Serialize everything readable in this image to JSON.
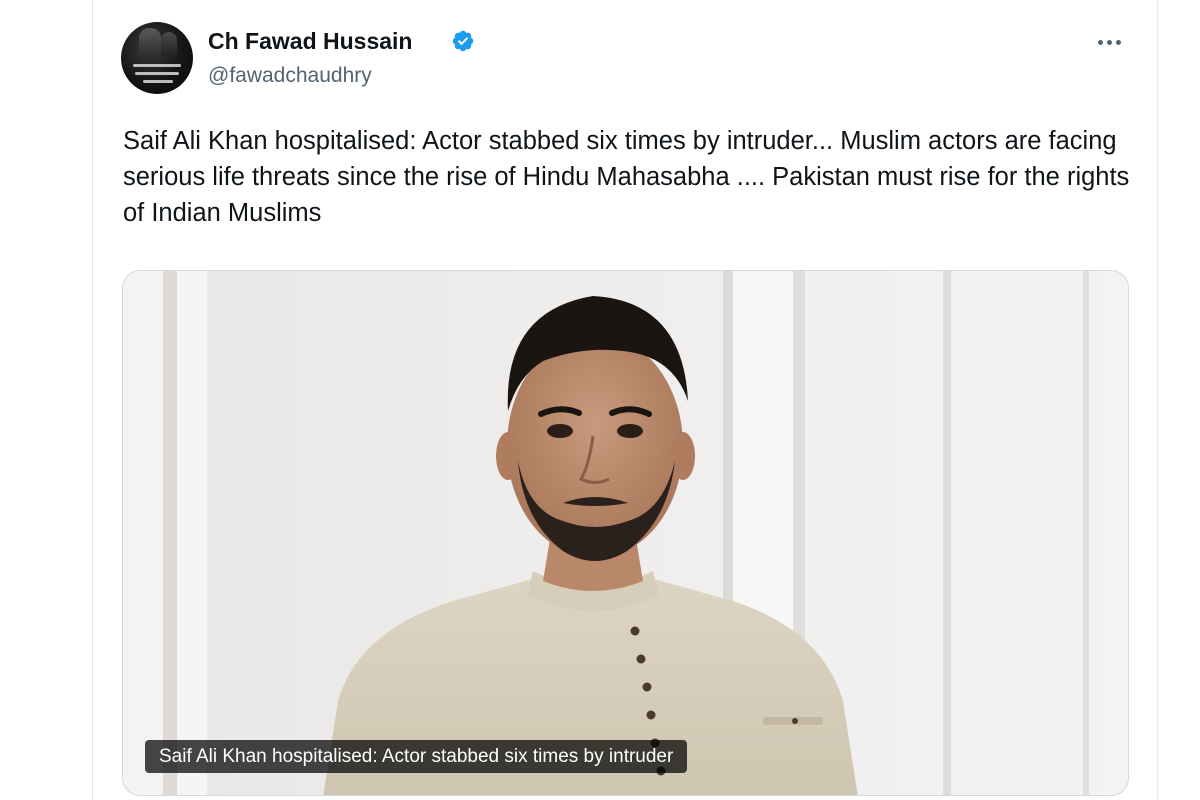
{
  "author": {
    "display_name": "Ch Fawad Hussain",
    "handle": "@fawadchaudhry",
    "verified": true
  },
  "tweet": {
    "text": "Saif Ali Khan hospitalised: Actor stabbed six times by intruder... Muslim actors are facing serious life threats since the rise of Hindu Mahasabha .... Pakistan must rise for the rights of Indian Muslims"
  },
  "media": {
    "caption": "Saif Ali Khan hospitalised: Actor stabbed six times by intruder"
  },
  "icons": {
    "verified": "verified-badge-icon",
    "more": "more-options-icon"
  },
  "colors": {
    "verified_badge": "#1d9bf0",
    "secondary_text": "#536471",
    "primary_text": "#0f1419",
    "border": "#cfd9de"
  }
}
